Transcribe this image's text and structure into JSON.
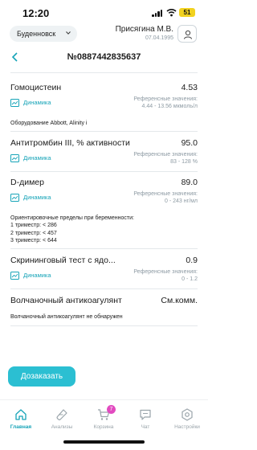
{
  "status_bar": {
    "time": "12:20",
    "battery": "51"
  },
  "header": {
    "city": "Буденновск",
    "patient_name": "Присягина М.В.",
    "patient_dob": "07.04.1995"
  },
  "order": {
    "title": "№0887442835637"
  },
  "dynamics_label": "Динамика",
  "reference_label": "Референсные значения:",
  "results": [
    {
      "name": "Гомоцистеин",
      "value": "4.53",
      "reference": "4.44 - 13.56 мкмоль/л",
      "note": "Оборудование Abbott, Alinity i"
    },
    {
      "name": "Антитромбин III, % активности",
      "value": "95.0",
      "reference": "83 - 128 %"
    },
    {
      "name": "D-димер",
      "value": "89.0",
      "reference": "0 - 243 нг/мл",
      "note_lines": [
        "Ориентировочные пределы при беременности:",
        "1 триместр: < 286",
        "2 триместр: < 457",
        "3 триместр: < 644"
      ]
    },
    {
      "name": "Скрининговый тест с ядо...",
      "value": "0.9",
      "reference": "0 - 1.2"
    },
    {
      "name": "Волчаночный антикоагулянт",
      "value": "См.комм.",
      "note": "Волчаночный антикоагулянт не обнаружен"
    }
  ],
  "actions": {
    "order_again": "Дозаказать"
  },
  "nav": {
    "items": [
      {
        "label": "Главная",
        "icon": "home-icon",
        "active": true
      },
      {
        "label": "Анализы",
        "icon": "test-tube-icon"
      },
      {
        "label": "Корзина",
        "icon": "cart-icon",
        "badge": "7"
      },
      {
        "label": "Чат",
        "icon": "chat-icon"
      },
      {
        "label": "Настройки",
        "icon": "settings-icon"
      }
    ]
  },
  "colors": {
    "accent": "#2bbfd2",
    "link": "#17a4b8",
    "badge": "#e24ac0",
    "muted": "#8d9aa3"
  }
}
